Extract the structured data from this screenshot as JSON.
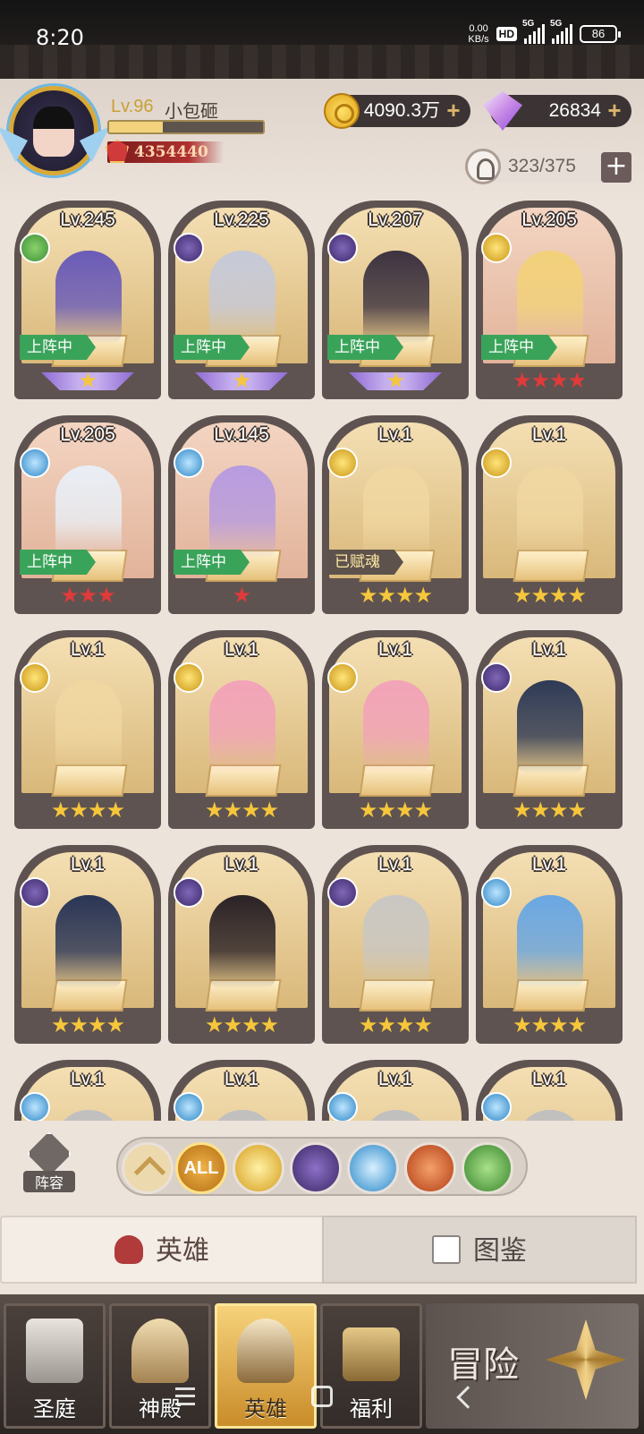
{
  "status_bar": {
    "time": "8:20",
    "net_speed_value": "0.00",
    "net_speed_unit": "KB/s",
    "hd_badge": "HD",
    "sim1_label": "5G",
    "sim2_label": "5G",
    "battery": "86"
  },
  "profile": {
    "level": "Lv.96",
    "name": "小包砸",
    "exp_fraction": 0.35,
    "power": "4354440"
  },
  "currencies": {
    "gold": "4090.3万",
    "gems": "26834",
    "hero_capacity": "323/375"
  },
  "heroes": [
    {
      "level": "Lv.245",
      "faction": "nature",
      "status": "上阵中",
      "stars": 1,
      "star_type": "wing"
    },
    {
      "level": "Lv.225",
      "faction": "dark",
      "status": "上阵中",
      "stars": 1,
      "star_type": "wing"
    },
    {
      "level": "Lv.207",
      "faction": "dark",
      "status": "上阵中",
      "stars": 1,
      "star_type": "wing"
    },
    {
      "level": "Lv.205",
      "faction": "light",
      "status": "上阵中",
      "stars": 4,
      "star_type": "red"
    },
    {
      "level": "Lv.205",
      "faction": "holy",
      "status": "上阵中",
      "stars": 3,
      "star_type": "red"
    },
    {
      "level": "Lv.145",
      "faction": "holy",
      "status": "上阵中",
      "stars": 1,
      "star_type": "red"
    },
    {
      "level": "Lv.1",
      "faction": "light",
      "status": "已赋魂",
      "stars": 4,
      "star_type": "gold"
    },
    {
      "level": "Lv.1",
      "faction": "light",
      "status": "",
      "stars": 4,
      "star_type": "gold"
    },
    {
      "level": "Lv.1",
      "faction": "light",
      "status": "",
      "stars": 4,
      "star_type": "gold"
    },
    {
      "level": "Lv.1",
      "faction": "light",
      "status": "",
      "stars": 4,
      "star_type": "gold"
    },
    {
      "level": "Lv.1",
      "faction": "light",
      "status": "",
      "stars": 4,
      "star_type": "gold"
    },
    {
      "level": "Lv.1",
      "faction": "dark",
      "status": "",
      "stars": 4,
      "star_type": "gold"
    },
    {
      "level": "Lv.1",
      "faction": "dark",
      "status": "",
      "stars": 4,
      "star_type": "gold"
    },
    {
      "level": "Lv.1",
      "faction": "dark",
      "status": "",
      "stars": 4,
      "star_type": "gold"
    },
    {
      "level": "Lv.1",
      "faction": "dark",
      "status": "",
      "stars": 4,
      "star_type": "gold"
    },
    {
      "level": "Lv.1",
      "faction": "holy",
      "status": "",
      "stars": 4,
      "star_type": "gold"
    },
    {
      "level": "Lv.1",
      "faction": "holy",
      "status": "",
      "stars": 0,
      "star_type": "gold"
    },
    {
      "level": "Lv.1",
      "faction": "holy",
      "status": "",
      "stars": 0,
      "star_type": "gold"
    },
    {
      "level": "Lv.1",
      "faction": "holy",
      "status": "",
      "stars": 0,
      "star_type": "gold"
    },
    {
      "level": "Lv.1",
      "faction": "holy",
      "status": "",
      "stars": 0,
      "star_type": "gold"
    }
  ],
  "filter": {
    "lineup_label": "阵容",
    "all_label": "ALL",
    "icons": [
      "sort-up-icon",
      "light-faction-icon",
      "dark-faction-icon",
      "holy-faction-icon",
      "beast-faction-icon",
      "nature-faction-icon"
    ]
  },
  "tabs": {
    "heroes": "英雄",
    "codex": "图鉴"
  },
  "bottom_nav": {
    "court": "圣庭",
    "shrine": "神殿",
    "heroes": "英雄",
    "welfare": "福利",
    "adventure": "冒险"
  },
  "colors": {
    "accent_gold": "#f6c63b",
    "deployed_green": "#3aa35a",
    "star_red": "#e03a3a"
  }
}
